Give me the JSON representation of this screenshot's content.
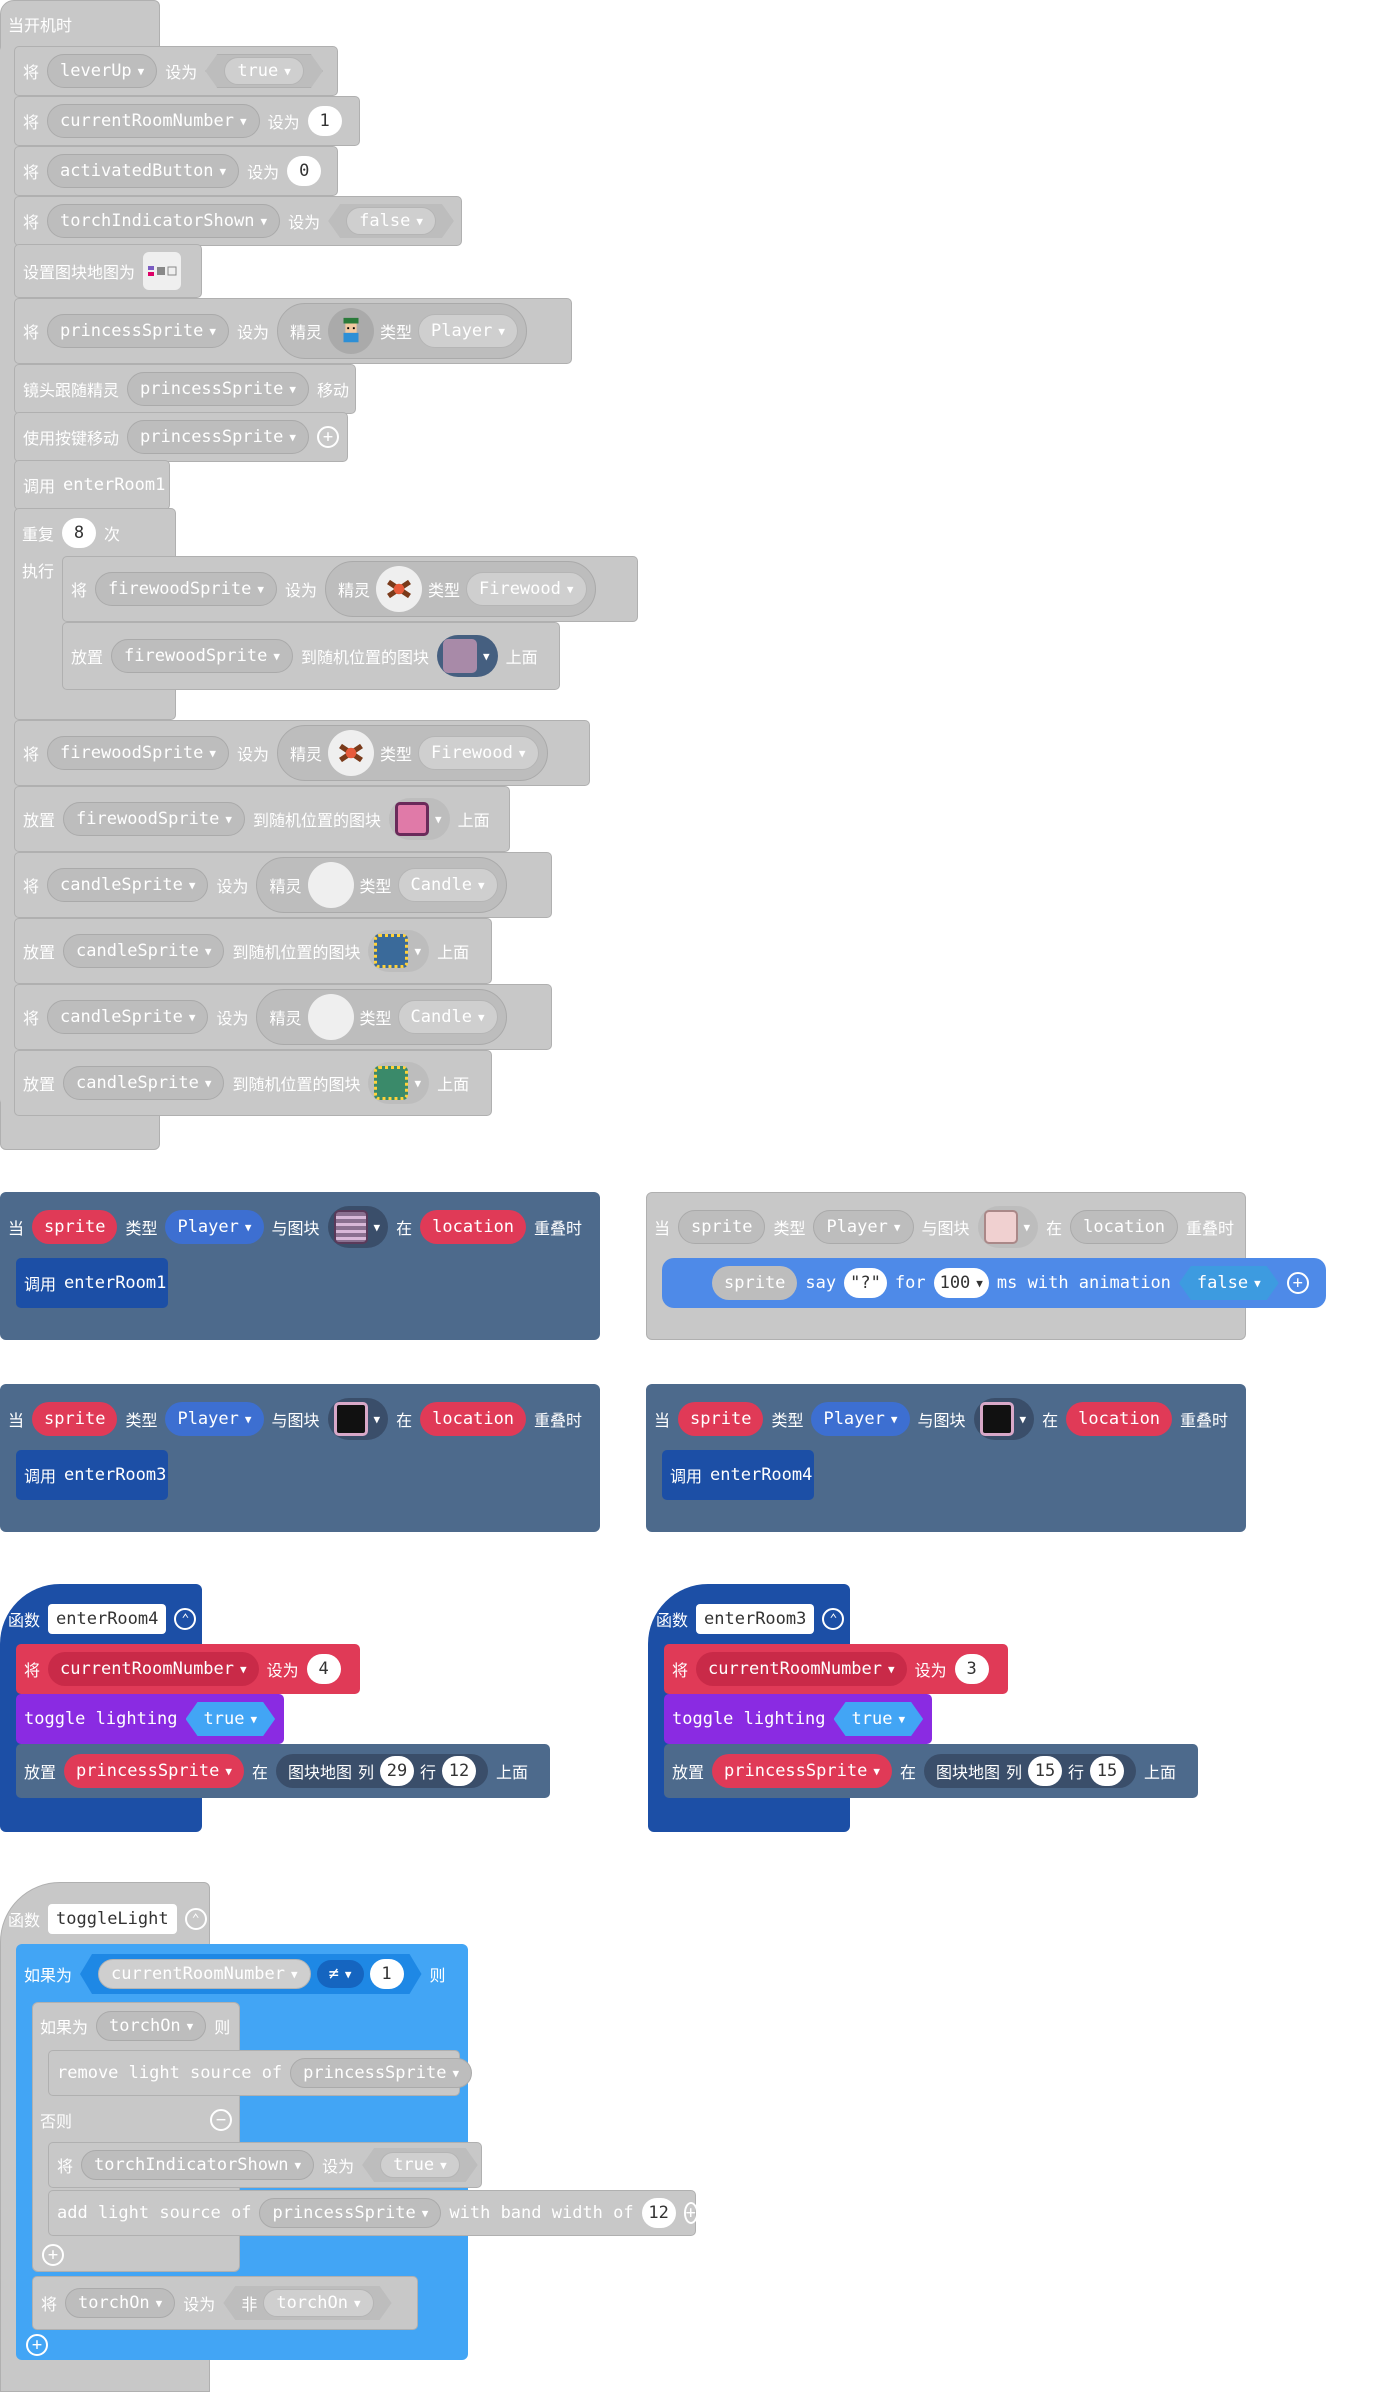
{
  "kw": {
    "when_start": "当开机时",
    "set": "将",
    "set_to": "设为",
    "set_tilemap": "设置图块地图为",
    "sprite": "精灵",
    "type": "类型",
    "camera_follow": "镜头跟随精灵",
    "move": "移动",
    "move_with_buttons": "使用按键移动",
    "call": "调用",
    "repeat": "重复",
    "times": "次",
    "do": "执行",
    "place": "放置",
    "on_random_tile": "到随机位置的图块",
    "on_top": "上面",
    "on": "当",
    "with_tile": "与图块",
    "at": "在",
    "overlap": "重叠时",
    "function": "函数",
    "tilemap": "图块地图",
    "col": "列",
    "row": "行",
    "if": "如果为",
    "then": "则",
    "else": "否则",
    "not": "非"
  },
  "start": {
    "vars": {
      "leverUp": "leverUp",
      "currentRoomNumber": "currentRoomNumber",
      "activatedButton": "activatedButton",
      "torchIndicatorShown": "torchIndicatorShown",
      "princessSprite": "princessSprite",
      "firewoodSprite": "firewoodSprite",
      "candleSprite": "candleSprite"
    },
    "values": {
      "true": "true",
      "false": "false",
      "one": "1",
      "zero": "0",
      "eight": "8"
    },
    "kinds": {
      "player": "Player",
      "firewood": "Firewood",
      "candle": "Candle"
    },
    "enterRoom1": "enterRoom1"
  },
  "events": {
    "sprite": "sprite",
    "player": "Player",
    "location": "location",
    "enterRoom1": "enterRoom1",
    "enterRoom3": "enterRoom3",
    "enterRoom4": "enterRoom4",
    "say": "say",
    "say_text": "\"?\"",
    "for": "for",
    "ms_val": "100",
    "ms_anim": "ms with animation",
    "false": "false"
  },
  "func4": {
    "name": "enterRoom4",
    "var": "currentRoomNumber",
    "value": "4",
    "toggle": "toggle lighting",
    "true": "true",
    "sprite": "princessSprite",
    "col": "29",
    "row": "12"
  },
  "func3": {
    "name": "enterRoom3",
    "var": "currentRoomNumber",
    "value": "3",
    "toggle": "toggle lighting",
    "true": "true",
    "sprite": "princessSprite",
    "col": "15",
    "row": "15"
  },
  "toggleLight": {
    "name": "toggleLight",
    "var": "currentRoomNumber",
    "op": "≠",
    "one": "1",
    "torchOn": "torchOn",
    "remove": "remove light source of",
    "princess": "princessSprite",
    "torchIndicatorShown": "torchIndicatorShown",
    "true": "true",
    "add": "add light source of",
    "band": "with band width of",
    "band_val": "12"
  },
  "colors": {
    "sprites_red": "#e03a57",
    "enum_blue": "#3d6fd1",
    "functions_blue": "#1c4fa6",
    "scene_slate": "#4d6a8c",
    "lighting_purple": "#8a2be2",
    "logic_cyan": "#42a5f5",
    "disabled_gray": "#c8c8c8"
  }
}
